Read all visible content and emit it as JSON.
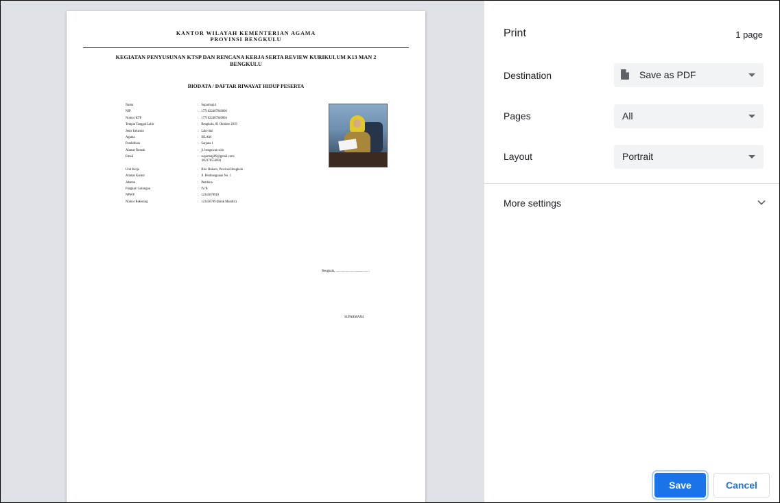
{
  "preview": {
    "document": {
      "org_line1": "KANTOR WILAYAH KEMENTERIAN AGAMA",
      "org_line2": "PROVINSI BENGKULU",
      "activity_line1": "KEGIATAN PENYUSUNAN KTSP DAN RENCANA KERJA SERTA REVIEW KURIKULUM K13 MAN 2",
      "activity_line2": "BENGKULU",
      "bio_title": "BIODATA / DAFTAR RIWAYAT HIDUP PESERTA",
      "fields": [
        {
          "label": "Nama",
          "value": "Suparmaji4"
        },
        {
          "label": "NIP",
          "value": "1771022407940006"
        },
        {
          "label": "Nomor KTP",
          "value": "1771022407940004"
        },
        {
          "label": "Tempat Tanggal Lahir",
          "value": "Bengkulu, 01 Oktober 2019"
        },
        {
          "label": "Jenis Kelamin",
          "value": "Laki-laki"
        },
        {
          "label": "Agama",
          "value": "ISLAM"
        },
        {
          "label": "Pendidikan",
          "value": "Sarjana 1"
        },
        {
          "label": "Alamat Rumah",
          "value": "jl. bengawan solo"
        },
        {
          "label": "Email",
          "value": "suparmaji89@gmail.com/",
          "value2": "082178556004"
        },
        {
          "label": "Unit Kerja",
          "value": "Biro Hukum, Provinsi Bengkulu"
        },
        {
          "label": "Alamat Kantor",
          "value": "Jl. Pembangunan No. 1"
        },
        {
          "label": "Jabatan",
          "value": "Pembina"
        },
        {
          "label": "Pangkat/ Golongan",
          "value": "IV/B"
        },
        {
          "label": "NPWP",
          "value": "12345678910"
        },
        {
          "label": "Nomor Rekening",
          "value": "123456789 (Bank Mandiri)"
        }
      ],
      "colon": ":",
      "place_date": "Bengkulu, ..........................................",
      "signature_name": "SUPARMAJI4"
    }
  },
  "panel": {
    "title": "Print",
    "page_count": "1 page",
    "destination": {
      "label": "Destination",
      "value": "Save as PDF",
      "icon": "file-icon"
    },
    "pages": {
      "label": "Pages",
      "value": "All"
    },
    "layout": {
      "label": "Layout",
      "value": "Portrait"
    },
    "more_settings": {
      "label": "More settings",
      "icon": "chevron-down-icon"
    },
    "save_label": "Save",
    "cancel_label": "Cancel"
  },
  "colors": {
    "accent": "#1a73e8",
    "preview_bg": "#dee1e6",
    "select_bg": "#f1f3f4",
    "text": "#202124"
  }
}
